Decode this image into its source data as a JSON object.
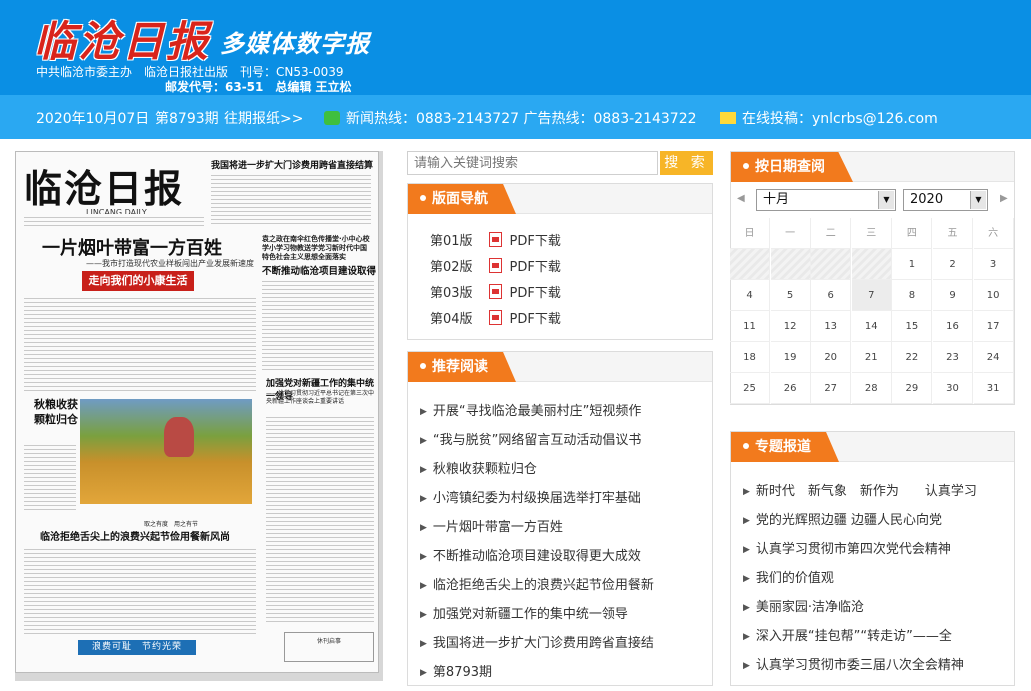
{
  "header": {
    "logo_text": "临沧日报",
    "logo_sub": "多媒体数字报",
    "line1": "中共临沧市委主办　临沧日报社出版　刊号：CN53-0039",
    "line2": "邮发代号：63-51　总编辑 王立松"
  },
  "infobar": {
    "date": "2020年10月07日",
    "issue": "第8793期",
    "past": "往期报纸>>",
    "hotline": "新闻热线：0883-2143727 广告热线：0883-2143722",
    "submit": "在线投稿：ynlcrbs@126.com"
  },
  "paper": {
    "masthead": "临沧日报",
    "english": "LINCANG DAILY",
    "top_headline": "我国将进一步扩大门诊费用跨省直接结算试点范围",
    "h1": "一片烟叶带富一方百姓",
    "h1_sub": "——我市打造现代农业样板闯出产业发展新速度",
    "red_banner": "走向我们的小康生活",
    "right_headline1": "袁之政在南伞红色传播堂·小中心校学小学习物教送学党习新时代中国特色社会主义思想全面落实",
    "right_headline2": "不断推动临沧项目建设取得更大成效",
    "side_title": "秋粮收获颗粒归仓",
    "right_headline3": "加强党对新疆工作的集中统一领导",
    "right_headline3_sub": "——论学习贯彻习近平总书记在第三次中央新疆工作座谈会上重要讲话",
    "mid_caption": "取之有度　用之有节",
    "h4": "临沧拒绝舌尖上的浪费兴起节俭用餐新风尚",
    "blue_banner": "浪费可耻　节约光荣",
    "box_text": "休刊启事"
  },
  "search": {
    "placeholder": "请输入关键词搜索",
    "button": "搜 索"
  },
  "nav_panel": {
    "title": "版面导航",
    "pdf_label": "PDF下载",
    "pages": [
      "第01版",
      "第02版",
      "第03版",
      "第04版"
    ]
  },
  "recommend": {
    "title": "推荐阅读",
    "items": [
      "开展“寻找临沧最美丽村庄”短视频作",
      "“我与脱贫”网络留言互动活动倡议书",
      "秋粮收获颗粒归仓",
      "小湾镇纪委为村级换届选举打牢基础",
      "一片烟叶带富一方百姓",
      "不断推动临沧项目建设取得更大成效",
      "临沧拒绝舌尖上的浪费兴起节俭用餐新",
      "加强党对新疆工作的集中统一领导",
      "我国将进一步扩大门诊费用跨省直接结",
      "第8793期"
    ]
  },
  "calendar": {
    "title": "按日期查阅",
    "month": "十月",
    "year": "2020",
    "weekdays": [
      "日",
      "一",
      "二",
      "三",
      "四",
      "五",
      "六"
    ],
    "weeks": [
      [
        "",
        "",
        "",
        "",
        "1",
        "2",
        "3"
      ],
      [
        "4",
        "5",
        "6",
        "7",
        "8",
        "9",
        "10"
      ],
      [
        "11",
        "12",
        "13",
        "14",
        "15",
        "16",
        "17"
      ],
      [
        "18",
        "19",
        "20",
        "21",
        "22",
        "23",
        "24"
      ],
      [
        "25",
        "26",
        "27",
        "28",
        "29",
        "30",
        "31"
      ]
    ]
  },
  "special": {
    "title": "专题报道",
    "items": [
      "新时代　新气象　新作为　　认真学习",
      "党的光辉照边疆 边疆人民心向党",
      "认真学习贯彻市第四次党代会精神",
      "我们的价值观",
      "美丽家园·洁净临沧",
      "深入开展“挂包帮”“转走访”——全",
      "认真学习贯彻市委三届八次全会精神"
    ]
  }
}
